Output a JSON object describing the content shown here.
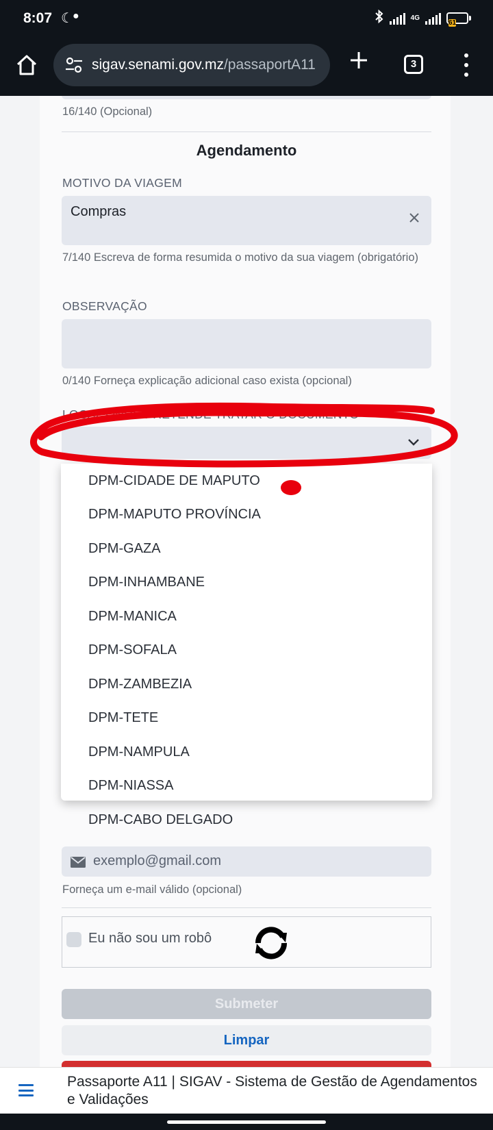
{
  "status_bar": {
    "time": "8:07",
    "network": "4G",
    "battery": "61"
  },
  "browser": {
    "url_host": "sigav.senami.gov.mz",
    "url_path": "/passaportA11",
    "tab_count": "3"
  },
  "form": {
    "prev_counter": "16/140 (Opcional)",
    "section_title": "Agendamento",
    "motivo": {
      "label": "MOTIVO DA VIAGEM",
      "value": "Compras",
      "hint": "7/140 Escreva de forma resumida o motivo da sua viagem (obrigatório)"
    },
    "observacao": {
      "label": "OBSERVAÇÃO",
      "value": "",
      "hint": "0/140 Forneça explicação adicional caso exista (opcional)"
    },
    "local": {
      "label": "LOCAL ONDE PRETENDE TRATAR O DOCUMENTO *",
      "value": "",
      "options": [
        "DPM-CIDADE DE MAPUTO",
        "DPM-MAPUTO PROVÍNCIA",
        "DPM-GAZA",
        "DPM-INHAMBANE",
        "DPM-MANICA",
        "DPM-SOFALA",
        "DPM-ZAMBEZIA",
        "DPM-TETE",
        "DPM-NAMPULA",
        "DPM-NIASSA",
        "DPM-CABO DELGADO"
      ]
    },
    "email": {
      "placeholder": "exemplo@gmail.com",
      "hint": "Forneça um e-mail válido (opcional)"
    },
    "captcha_label": "Eu não sou um robô",
    "submit_label": "Submeter",
    "clear_label": "Limpar"
  },
  "footer": {
    "title": "Passaporte A11 | SIGAV - Sistema de Gestão de Agendamentos e Validações"
  },
  "colors": {
    "accent": "#1565c0",
    "annotation": "#e8000d",
    "danger": "#d32f2f"
  }
}
